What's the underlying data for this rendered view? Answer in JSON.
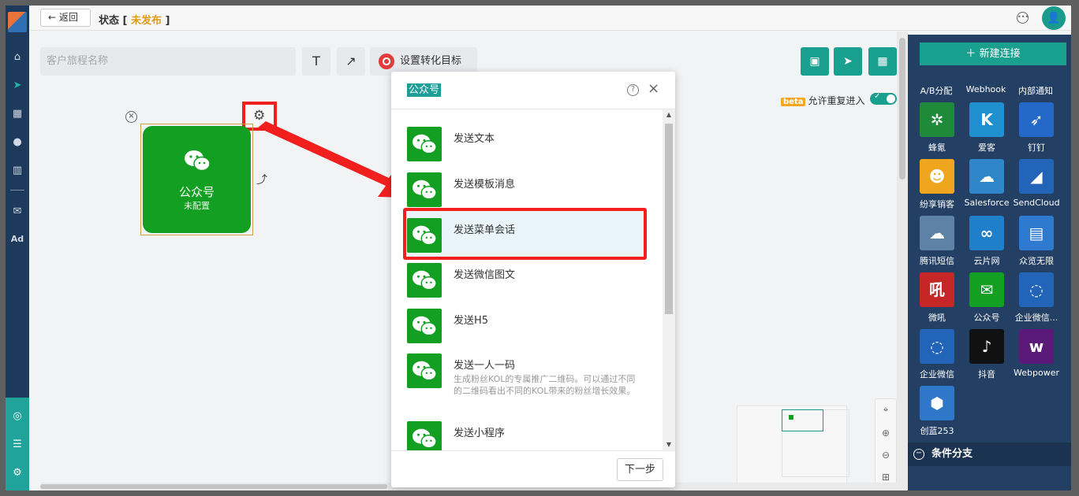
{
  "topbar": {
    "back_label": "返回",
    "status_label": "状态",
    "status_value": "未发布"
  },
  "leftnav": {
    "icons": [
      "home-icon",
      "send-icon",
      "layout-icon",
      "user-icon",
      "chart-icon",
      "wechat-icon",
      "ad-icon"
    ],
    "ad_label": "Ad"
  },
  "toolbar": {
    "journey_name_placeholder": "客户旅程名称",
    "text_tool": "T",
    "arrow_tool": "↗",
    "set_target_label": "设置转化目标",
    "beta_tag": "beta",
    "repeat_entry_label": "允许重复进入"
  },
  "node": {
    "title": "公众号",
    "subtitle": "未配置"
  },
  "right_panel": {
    "new_connection_label": "新建连接",
    "top_row": [
      "A/B分配",
      "Webhook",
      "内部通知"
    ],
    "tiles": [
      {
        "label": "蜂氪",
        "color": "#1e8a3a",
        "icon": "spider-icon",
        "glyph": "✲"
      },
      {
        "label": "爱客",
        "color": "#1e8fcf",
        "icon": "aike-icon",
        "glyph": "K"
      },
      {
        "label": "钉钉",
        "color": "#2469c7",
        "icon": "dingtalk-icon",
        "glyph": "➶"
      },
      {
        "label": "纷享销客",
        "color": "#f0a51e",
        "icon": "fxiaoke-icon",
        "glyph": "☻"
      },
      {
        "label": "Salesforce",
        "color": "#2f86c8",
        "icon": "salesforce-icon",
        "glyph": "☁"
      },
      {
        "label": "SendCloud",
        "color": "#2164b8",
        "icon": "sendcloud-icon",
        "glyph": "◢"
      },
      {
        "label": "腾讯短信",
        "color": "#5e81a6",
        "icon": "tencent-sms-icon",
        "glyph": "☁"
      },
      {
        "label": "云片网",
        "color": "#1f7fca",
        "icon": "yunpian-icon",
        "glyph": "∞"
      },
      {
        "label": "众览无限",
        "color": "#2e7ad1",
        "icon": "zhonglan-icon",
        "glyph": "▤"
      },
      {
        "label": "微吼",
        "color": "#c72626",
        "icon": "vhall-icon",
        "glyph": "吼"
      },
      {
        "label": "公众号",
        "color": "#13a022",
        "icon": "wechat-icon",
        "glyph": "✉"
      },
      {
        "label": "企业微信...",
        "color": "#2164b8",
        "icon": "wecom-icon",
        "glyph": "◌"
      },
      {
        "label": "企业微信",
        "color": "#2164b8",
        "icon": "wecom-icon",
        "glyph": "◌"
      },
      {
        "label": "抖音",
        "color": "#111111",
        "icon": "douyin-icon",
        "glyph": "♪"
      },
      {
        "label": "Webpower",
        "color": "#5b1a7a",
        "icon": "webpower-icon",
        "glyph": "w"
      },
      {
        "label": "创蓝253",
        "color": "#2f78c9",
        "icon": "chuanglan-icon",
        "glyph": "⬢"
      }
    ],
    "section_label": "条件分支"
  },
  "modal": {
    "title": "公众号",
    "next_label": "下一步",
    "items": [
      {
        "label": "发送文本",
        "desc": ""
      },
      {
        "label": "发送模板消息",
        "desc": ""
      },
      {
        "label": "发送菜单会话",
        "desc": ""
      },
      {
        "label": "发送微信图文",
        "desc": ""
      },
      {
        "label": "发送H5",
        "desc": ""
      },
      {
        "label": "发送一人一码",
        "desc": "生成粉丝KOL的专属推广二维码。可以通过不同的二维码看出不同的KOL带来的粉丝增长效果。"
      },
      {
        "label": "发送小程序",
        "desc": ""
      }
    ]
  },
  "colors": {
    "brand": "#1aa08f",
    "wechat_green": "#13a022",
    "highlight_red": "#f21f1f",
    "nav_bg": "#1d3a5c",
    "status_orange": "#e29a1a"
  }
}
